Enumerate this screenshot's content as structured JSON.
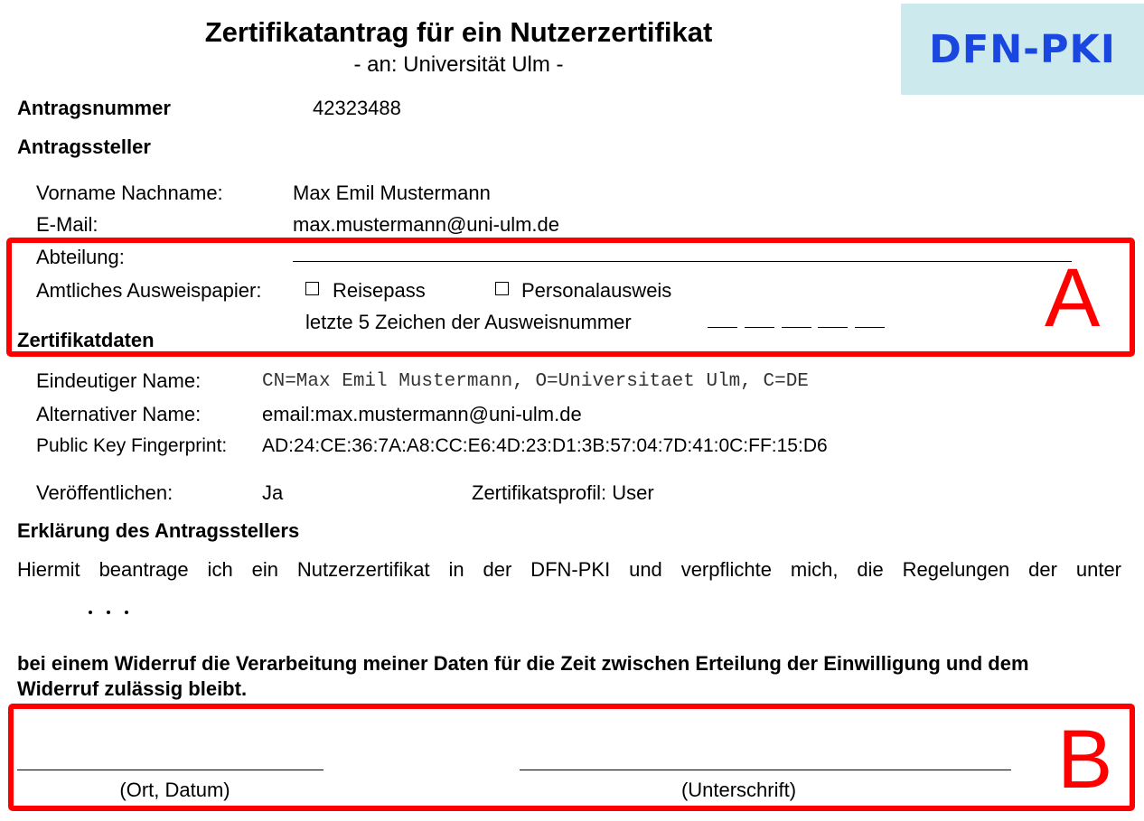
{
  "header": {
    "title": "Zertifikatantrag für ein Nutzerzertifikat",
    "subtitle": "- an: Universität Ulm -",
    "logo_text": "DFN-PKI"
  },
  "antragsnummer": {
    "label": "Antragsnummer",
    "value": "42323488"
  },
  "antragssteller": {
    "heading": "Antragssteller",
    "name_label": "Vorname Nachname:",
    "name_value": "Max Emil Mustermann",
    "email_label": "E-Mail:",
    "email_value": "max.mustermann@uni-ulm.de",
    "abteilung_label": "Abteilung:",
    "ausweis_label": "Amtliches Ausweispapier:",
    "option_reisepass": "Reisepass",
    "option_personalausweis": "Personalausweis",
    "ausweisnummer_label": "letzte 5 Zeichen der Ausweisnummer"
  },
  "zertifikatdaten": {
    "heading": "Zertifikatdaten",
    "eindeutiger_label": "Eindeutiger Name:",
    "eindeutiger_value": "CN=Max Emil Mustermann, O=Universitaet Ulm, C=DE",
    "alternativer_label": "Alternativer Name:",
    "alternativer_value": "email:max.mustermann@uni-ulm.de",
    "fingerprint_label": "Public Key Fingerprint:",
    "fingerprint_value": "AD:24:CE:36:7A:A8:CC:E6:4D:23:D1:3B:57:04:7D:41:0C:FF:15:D6",
    "veroeffentlichen_label": "Veröffentlichen:",
    "veroeffentlichen_value": "Ja",
    "profil_text": "Zertifikatsprofil: User"
  },
  "erklaerung": {
    "heading": "Erklärung des Antragsstellers",
    "text": "Hiermit beantrage ich ein Nutzerzertifikat in der DFN-PKI und verpflichte mich, die Regelungen der unter",
    "closing_line1": "bei einem Widerruf die Verarbeitung meiner Daten für die Zeit zwischen Erteilung der Einwilligung und dem",
    "closing_line2": "Widerruf zulässig bleibt."
  },
  "signature": {
    "ort_datum_label": "(Ort, Datum)",
    "unterschrift_label": "(Unterschrift)"
  },
  "annotations": {
    "box_a_label": "A",
    "box_b_label": "B",
    "color": "#ff0000"
  }
}
